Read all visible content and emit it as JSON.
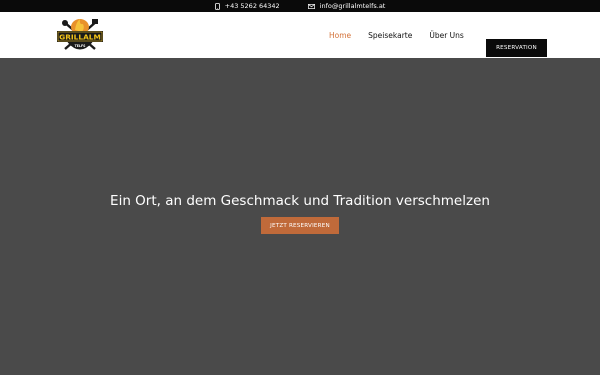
{
  "topbar": {
    "phone": "+43 5262 64342",
    "email": "info@grillalmtelfs.at",
    "phone_icon": "phone-icon",
    "email_icon": "mail-icon"
  },
  "logo": {
    "text": "GRILLALM",
    "subtext": "TELFS"
  },
  "nav": {
    "items": [
      {
        "label": "Home",
        "active": true
      },
      {
        "label": "Speisekarte",
        "active": false
      },
      {
        "label": "Über Uns",
        "active": false
      }
    ],
    "reservation_label": "RESERVATION"
  },
  "hero": {
    "title": "Ein Ort, an dem Geschmack und Tradition verschmelzen",
    "button_label": "JETZT RESERVIEREN"
  },
  "colors": {
    "accent": "#d4733a",
    "button": "#c06a3a",
    "hero_bg": "#4a4a4a",
    "topbar_bg": "#0a0a0a"
  }
}
